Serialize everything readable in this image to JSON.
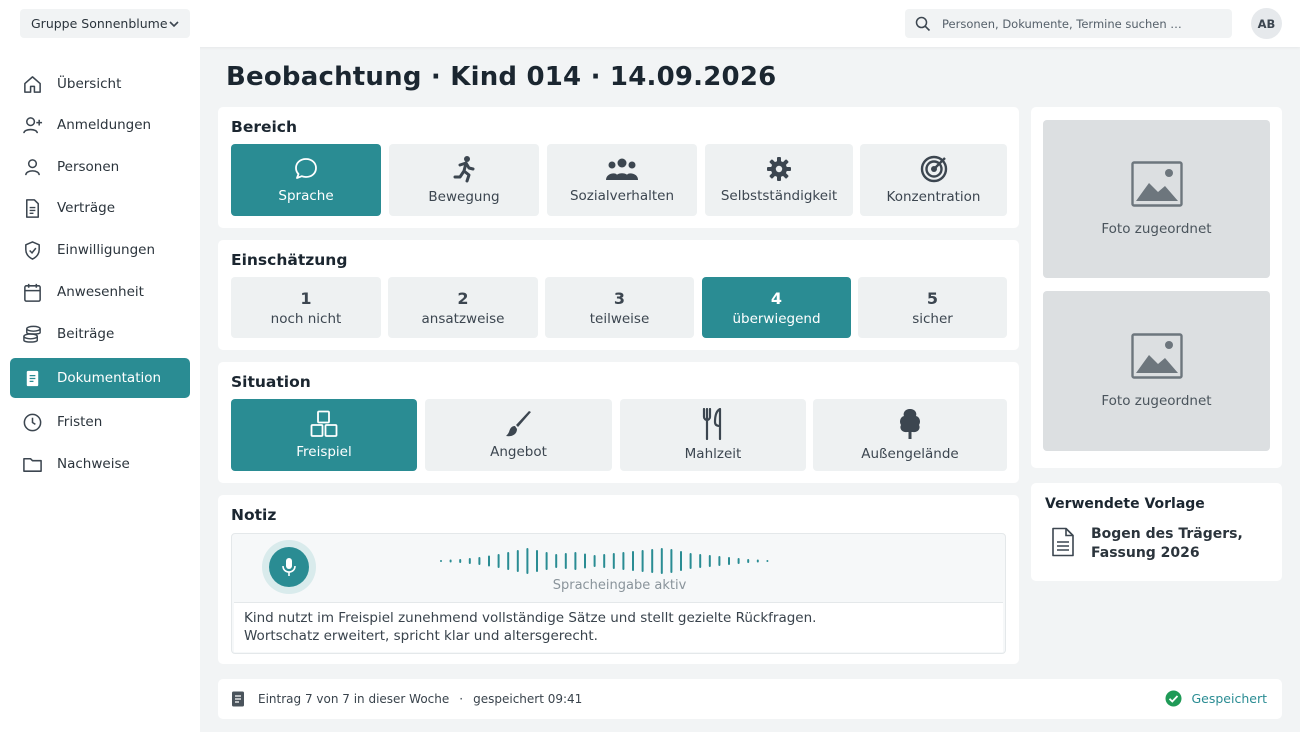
{
  "topbar": {
    "group": "Gruppe Sonnenblume",
    "search_placeholder": "Personen, Dokumente, Termine suchen …",
    "avatar": "AB"
  },
  "sidebar": {
    "items": [
      {
        "label": "Übersicht",
        "icon": "home-icon"
      },
      {
        "label": "Anmeldungen",
        "icon": "user-plus-icon"
      },
      {
        "label": "Personen",
        "icon": "person-icon"
      },
      {
        "label": "Verträge",
        "icon": "document-icon"
      },
      {
        "label": "Einwilligungen",
        "icon": "shield-check-icon"
      },
      {
        "label": "Anwesenheit",
        "icon": "calendar-icon"
      },
      {
        "label": "Beiträge",
        "icon": "coins-icon"
      },
      {
        "label": "Dokumentation",
        "icon": "notes-icon",
        "active": true
      },
      {
        "label": "Fristen",
        "icon": "clock-icon"
      },
      {
        "label": "Nachweise",
        "icon": "folder-icon"
      }
    ]
  },
  "page": {
    "title": "Beobachtung · Kind 014 · 14.09.2026"
  },
  "bereich": {
    "title": "Bereich",
    "options": [
      {
        "label": "Sprache",
        "icon": "speech-bubble-icon",
        "selected": true
      },
      {
        "label": "Bewegung",
        "icon": "running-icon"
      },
      {
        "label": "Sozialverhalten",
        "icon": "group-icon"
      },
      {
        "label": "Selbstständigkeit",
        "icon": "gear-icon"
      },
      {
        "label": "Konzentration",
        "icon": "target-icon"
      }
    ]
  },
  "einschaetzung": {
    "title": "Einschätzung",
    "options": [
      {
        "value": "1",
        "label": "noch nicht"
      },
      {
        "value": "2",
        "label": "ansatzweise"
      },
      {
        "value": "3",
        "label": "teilweise"
      },
      {
        "value": "4",
        "label": "überwiegend",
        "selected": true
      },
      {
        "value": "5",
        "label": "sicher"
      }
    ]
  },
  "situation": {
    "title": "Situation",
    "options": [
      {
        "label": "Freispiel",
        "icon": "blocks-icon",
        "selected": true
      },
      {
        "label": "Angebot",
        "icon": "brush-icon"
      },
      {
        "label": "Mahlzeit",
        "icon": "fork-knife-icon"
      },
      {
        "label": "Außengelände",
        "icon": "tree-icon"
      }
    ]
  },
  "notiz": {
    "title": "Notiz",
    "voice_status": "Spracheingabe aktiv",
    "text_line1": "Kind nutzt im Freispiel zunehmend vollständige Sätze und stellt gezielte Rückfragen.",
    "text_line2": "Wortschatz erweitert, spricht klar und altersgerecht."
  },
  "photos": [
    {
      "label": "Foto zugeordnet"
    },
    {
      "label": "Foto zugeordnet"
    }
  ],
  "vorlage": {
    "title": "Verwendete Vorlage",
    "name_line1": "Bogen des Trägers,",
    "name_line2": "Fassung 2026"
  },
  "status": {
    "entry": "Eintrag 7 von 7 in dieser Woche",
    "separator": "·",
    "saved_time": "gespeichert 09:41",
    "saved_label": "Gespeichert"
  },
  "colors": {
    "accent": "#2a8c93",
    "background": "#f2f4f5",
    "tile": "#eef1f2"
  }
}
